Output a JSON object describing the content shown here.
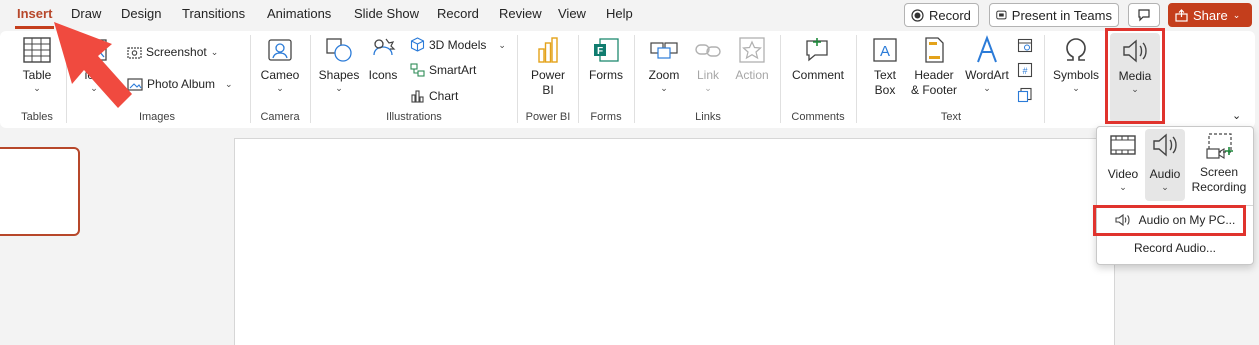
{
  "menu": {
    "tabs": [
      "Insert",
      "Draw",
      "Design",
      "Transitions",
      "Animations",
      "Slide Show",
      "Record",
      "Review",
      "View",
      "Help"
    ],
    "record_button": "Record",
    "present_button": "Present in Teams",
    "share_button": "Share"
  },
  "ribbon": {
    "table": {
      "label": "Table",
      "group": "Tables"
    },
    "images": {
      "pictures": "ictu",
      "screenshot": "Screenshot",
      "photo_album": "Photo Album",
      "group": "Images"
    },
    "camera": {
      "label": "Cameo",
      "group": "Camera"
    },
    "illustrations": {
      "shapes": "Shapes",
      "icons": "Icons",
      "models": "3D Models",
      "smartart": "SmartArt",
      "chart": "Chart",
      "group": "Illustrations"
    },
    "powerbi": {
      "label_line1": "Power",
      "label_line2": "BI",
      "group": "Power BI"
    },
    "forms": {
      "label": "Forms",
      "group": "Forms"
    },
    "links": {
      "zoom": "Zoom",
      "link": "Link",
      "action": "Action",
      "group": "Links"
    },
    "comments": {
      "label": "Comment",
      "group": "Comments"
    },
    "text": {
      "textbox_line1": "Text",
      "textbox_line2": "Box",
      "header_line1": "Header",
      "header_line2": "& Footer",
      "wordart": "WordArt",
      "group": "Text"
    },
    "symbols": {
      "label": "Symbols"
    },
    "media": {
      "label": "Media"
    }
  },
  "media_menu": {
    "video": "Video",
    "audio": "Audio",
    "screen_line1": "Screen",
    "screen_line2": "Recording",
    "audio_on_pc": "Audio on My PC...",
    "record_audio": "Record Audio..."
  },
  "colors": {
    "accent": "#c43e1c",
    "highlight": "#e0332d",
    "arrow": "#f04a3f"
  }
}
